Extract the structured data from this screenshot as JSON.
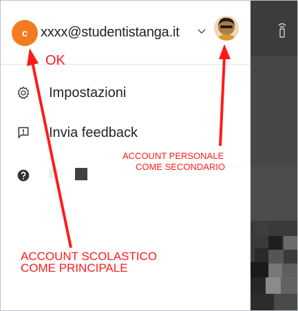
{
  "account": {
    "avatar_initial": "c",
    "email": "xxxx@studentistanga.it",
    "chevron": "˅",
    "avatar_color": "#f47b20"
  },
  "menu": {
    "items": [
      {
        "label": "Impostazioni",
        "icon": "gear-icon"
      },
      {
        "label": "Invia feedback",
        "icon": "feedback-icon"
      }
    ],
    "help_icon": "help-icon"
  },
  "annotations": {
    "ok": "OK",
    "personal_line1": "ACCOUNT PERSONALE",
    "personal_line2": "COME SECONDARIO",
    "school_line1": "ACCOUNT SCOLASTICO",
    "school_line2": "COME PRINCIPALE",
    "color": "#ff1a1a"
  },
  "side": {
    "icon": "remote-icon"
  }
}
